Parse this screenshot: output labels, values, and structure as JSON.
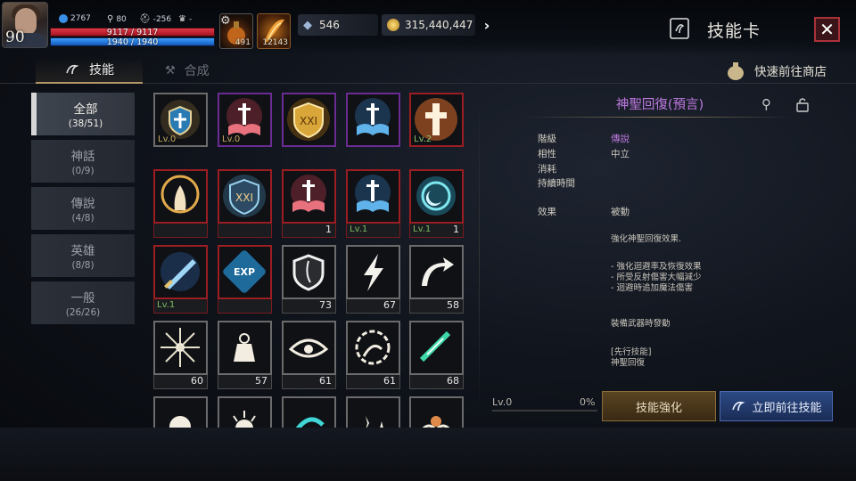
{
  "player": {
    "level": "90",
    "stat_a": "2767",
    "stat_b": "80",
    "stat_c": "-256",
    "stat_d": "-",
    "hp": "9117 / 9117",
    "mp": "1940 / 1940",
    "slot1_count": "491",
    "slot2_count": "12143"
  },
  "currency": {
    "crystal": "546",
    "gold": "315,440,447"
  },
  "header": {
    "title": "技能卡",
    "close_icon": "close-x-icon"
  },
  "tabs": {
    "skill": "技能",
    "craft": "合成"
  },
  "shop_link": "快速前往商店",
  "categories": [
    {
      "name": "全部",
      "count": "(38/51)"
    },
    {
      "name": "神話",
      "count": "(0/9)"
    },
    {
      "name": "傳說",
      "count": "(4/8)"
    },
    {
      "name": "英雄",
      "count": "(8/8)"
    },
    {
      "name": "一般",
      "count": "(26/26)"
    }
  ],
  "grid": [
    {
      "icon": "shield-cross-icon",
      "rarity": "gray",
      "level": "Lv.0",
      "level_style": "gold",
      "qty": "",
      "selected": true,
      "where": "tile"
    },
    {
      "icon": "red-book-icon",
      "rarity": "purple",
      "level": "Lv.0",
      "level_style": "gold",
      "qty": "",
      "where": "tile"
    },
    {
      "icon": "gold-shield-icon",
      "rarity": "purple",
      "level": "",
      "qty": "",
      "where": "tile"
    },
    {
      "icon": "blue-book-icon",
      "rarity": "purple",
      "level": "",
      "qty": "",
      "where": "tile"
    },
    {
      "icon": "holy-cross-icon",
      "rarity": "red",
      "level": "Lv.2",
      "level_style": "green",
      "qty": "",
      "where": "tile"
    },
    {
      "icon": "praying-hands-icon",
      "rarity": "red",
      "level": "",
      "qty": "",
      "where": "strip"
    },
    {
      "icon": "holy-shield-icon",
      "rarity": "red",
      "level": "",
      "qty": "",
      "where": "strip"
    },
    {
      "icon": "red-book-icon",
      "rarity": "red",
      "level": "",
      "qty": "1",
      "where": "strip"
    },
    {
      "icon": "blue-book-icon",
      "rarity": "red",
      "level": "Lv.1",
      "level_style": "green",
      "qty": "",
      "where": "strip"
    },
    {
      "icon": "moon-star-icon",
      "rarity": "red",
      "level": "Lv.1",
      "level_style": "green",
      "qty": "1",
      "where": "strip"
    },
    {
      "icon": "sword-slash-icon",
      "rarity": "red",
      "level": "Lv.1",
      "level_style": "green",
      "qty": "",
      "where": "strip"
    },
    {
      "icon": "exp-badge-icon",
      "rarity": "red",
      "level": "",
      "qty": "",
      "where": "strip"
    },
    {
      "icon": "silver-shield-icon",
      "rarity": "gray",
      "level": "",
      "qty": "73",
      "where": "strip"
    },
    {
      "icon": "lightning-icon",
      "rarity": "gray",
      "level": "",
      "qty": "67",
      "where": "strip"
    },
    {
      "icon": "curved-arrow-icon",
      "rarity": "gray",
      "level": "",
      "qty": "58",
      "where": "strip"
    },
    {
      "icon": "burst-icon",
      "rarity": "gray",
      "level": "",
      "qty": "60",
      "where": "strip"
    },
    {
      "icon": "weight-icon",
      "rarity": "gray",
      "level": "",
      "qty": "57",
      "where": "strip"
    },
    {
      "icon": "eye-icon",
      "rarity": "gray",
      "level": "",
      "qty": "61",
      "where": "strip"
    },
    {
      "icon": "serpent-icon",
      "rarity": "gray",
      "level": "",
      "qty": "61",
      "where": "strip"
    },
    {
      "icon": "green-slash-icon",
      "rarity": "gray",
      "level": "",
      "qty": "68",
      "where": "strip"
    },
    {
      "icon": "orb-icon",
      "rarity": "gray",
      "level": "",
      "qty": "",
      "where": "strip"
    },
    {
      "icon": "sun-face-icon",
      "rarity": "gray",
      "level": "",
      "qty": "",
      "where": "strip"
    },
    {
      "icon": "cyan-swirl-icon",
      "rarity": "gray",
      "level": "",
      "qty": "",
      "where": "strip"
    },
    {
      "icon": "sparkle-icon",
      "rarity": "gray",
      "level": "",
      "qty": "",
      "where": "strip"
    },
    {
      "icon": "wave-icon",
      "rarity": "gray",
      "level": "",
      "qty": "",
      "where": "strip"
    }
  ],
  "detail": {
    "name": "神聖回復(預言)",
    "grade_label": "階級",
    "grade_value": "傳說",
    "affinity_label": "相性",
    "affinity_value": "中立",
    "cost_label": "消耗",
    "duration_label": "持續時間",
    "effect_label": "效果",
    "effect_value": "被動",
    "desc1": "強化神聖回復效果.",
    "desc2": "- 強化迴避率及恢復效果\n- 所受反射傷害大幅減少\n- 迴避時追加魔法傷害",
    "desc3": "裝備武器時發動",
    "desc4": "[先行技能]\n神聖回復"
  },
  "progress": {
    "level_text": "Lv.0",
    "percent_text": "0%",
    "fraction": 0
  },
  "buttons": {
    "enhance": "技能強化",
    "goto": "立即前往技能"
  }
}
